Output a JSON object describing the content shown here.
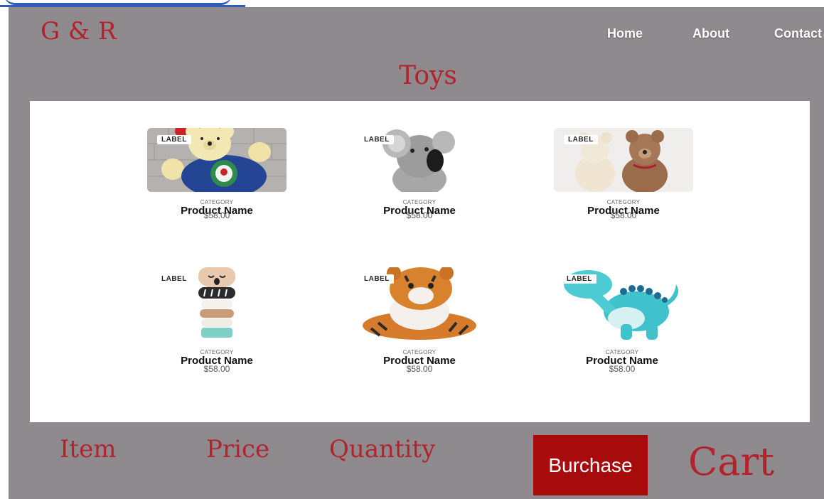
{
  "brand": "G & R",
  "nav": [
    "Home",
    "About",
    "Contact"
  ],
  "page_title": "Toys",
  "products": [
    {
      "label": "LABEL",
      "category": "CATEGORY",
      "name": "Product Name",
      "price": "$58.00",
      "image": "teddy bear in blue sweater"
    },
    {
      "label": "LABEL",
      "category": "CATEGORY",
      "name": "Product Name",
      "price": "$58.00",
      "image": "grey koala plush"
    },
    {
      "label": "LABEL",
      "category": "CATEGORY",
      "name": "Product Name",
      "price": "$58.00",
      "image": "two teddy bears"
    },
    {
      "label": "LABEL",
      "category": "CATEGORY",
      "name": "Product Name",
      "price": "$58.00",
      "image": "wooden stacking koala toy"
    },
    {
      "label": "LABEL",
      "category": "CATEGORY",
      "name": "Product Name",
      "price": "$58.00",
      "image": "tiger plush"
    },
    {
      "label": "LABEL",
      "category": "CATEGORY",
      "name": "Product Name",
      "price": "$58.00",
      "image": "teal dinosaur plush"
    }
  ],
  "footer": {
    "item": "Item",
    "price": "Price",
    "quantity": "Quantity",
    "purchase_button": "Burchase",
    "cart": "Cart"
  },
  "colors": {
    "frame": "#8e8a8e",
    "accent": "#b3232d",
    "button": "#a80b0b"
  }
}
